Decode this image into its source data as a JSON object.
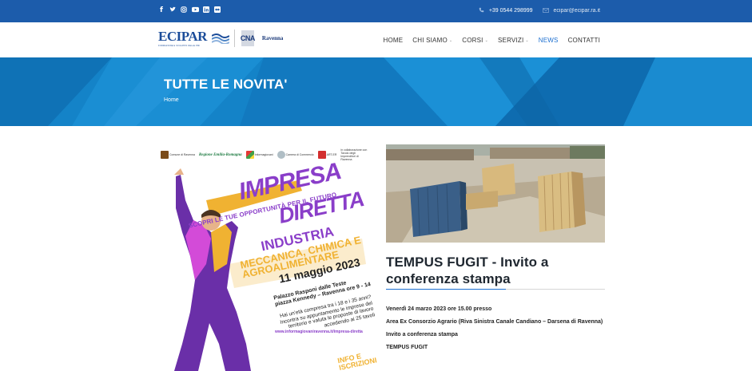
{
  "topbar": {
    "social": [
      {
        "name": "facebook-icon",
        "glyph": "f"
      },
      {
        "name": "twitter-icon",
        "glyph": "🐦"
      },
      {
        "name": "instagram-icon",
        "glyph": "◎"
      },
      {
        "name": "youtube-icon",
        "glyph": "▶"
      },
      {
        "name": "linkedin-icon",
        "glyph": "in"
      },
      {
        "name": "flickr-icon",
        "glyph": "••"
      }
    ],
    "phone": "+39 0544 298999",
    "email": "ecipar@ecipar.ra.it"
  },
  "header": {
    "logo_text": "ECIPAR",
    "logo_sub": "FORMAZIONE E SVILUPPO DELLE PMI",
    "cna_text": "CNA",
    "cna_city": "Ravenna",
    "nav": [
      {
        "label": "HOME",
        "dropdown": false,
        "active": false
      },
      {
        "label": "CHI SIAMO",
        "dropdown": true,
        "active": false
      },
      {
        "label": "CORSI",
        "dropdown": true,
        "active": false
      },
      {
        "label": "SERVIZI",
        "dropdown": true,
        "active": false
      },
      {
        "label": "NEWS",
        "dropdown": false,
        "active": true
      },
      {
        "label": "CONTATTI",
        "dropdown": false,
        "active": false
      }
    ]
  },
  "banner": {
    "title": "TUTTE LE NOVITA'",
    "breadcrumb": "Home"
  },
  "poster": {
    "logos": [
      "Comune di Ravenna",
      "Regione Emilia-Romagna",
      "Informagiovani",
      "Camera di Commercio",
      "ART-ER",
      "in collaborazione con Tavolo degli Imprenditori di Ravenna"
    ],
    "impresa": "IMPRESA",
    "diretta": "DIRETTA",
    "scopri": "SCOPRI LE TUE OPPORTUNITÀ PER IL FUTURO",
    "industria": "INDUSTRIA",
    "sectors": "MECCANICA, CHIMICA E AGROALIMENTARE",
    "date": "11 maggio 2023",
    "venue": "Palazzo Rasponi dalle Teste",
    "address": "piazza Kennedy – Ravenna ore 9 - 14",
    "age_text": "Hai un'età compresa tra i 18 e i 35 anni? Incontra su appuntamento le imprese del territorio e valuta le proposte di lavoro accedendo ai 25 tavoli",
    "url": "www.informagiovaniravenna.it/impresa-diretta",
    "info": "INFO E ISCRIZIONI"
  },
  "article": {
    "title": "TEMPUS FUGIT - Invito a conferenza stampa",
    "paragraphs": [
      "Venerdì 24 marzo 2023 ore 15.00 presso",
      "Area Ex Consorzio Agrario (Riva Sinistra Canale Candiano – Darsena di Ravenna)",
      "Invito a conferenza stampa",
      "TEMPUS FUGIT"
    ]
  },
  "colors": {
    "topbar": "#1c5cab",
    "banner": "#1483c8",
    "accent": "#1c6fd0",
    "poster_purple": "#8a3ec9",
    "poster_yellow": "#f0b232"
  }
}
